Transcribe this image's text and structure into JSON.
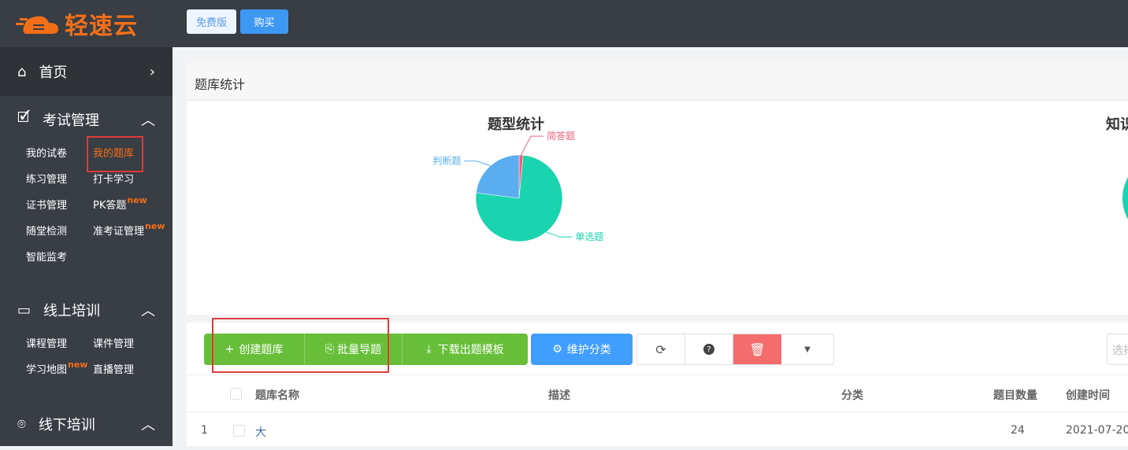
{
  "header": {
    "logo_text": "轻速云",
    "free_label": "免费版",
    "buy_label": "购买"
  },
  "sidebar": {
    "home": "首页",
    "exam": {
      "label": "考试管理",
      "items": [
        {
          "label": "我的试卷"
        },
        {
          "label": "我的题库",
          "active": true
        },
        {
          "label": "练习管理"
        },
        {
          "label": "打卡学习"
        },
        {
          "label": "证书管理"
        },
        {
          "label": "PK答题",
          "badge": "new"
        },
        {
          "label": "随堂检测"
        },
        {
          "label": "准考证管理",
          "badge": "new"
        },
        {
          "label": "智能监考"
        }
      ]
    },
    "online": {
      "label": "线上培训",
      "items": [
        {
          "label": "课程管理"
        },
        {
          "label": "课件管理"
        },
        {
          "label": "学习地图",
          "badge": "new"
        },
        {
          "label": "直播管理"
        }
      ]
    },
    "offline": {
      "label": "线下培训"
    }
  },
  "stats": {
    "title": "题库统计",
    "chart2_title": "知识点统计"
  },
  "chart_data": {
    "type": "pie",
    "title": "题型统计",
    "categories": [
      "单选题",
      "判断题",
      "简答题"
    ],
    "values": [
      75.5,
      23,
      1.5
    ],
    "colors": [
      "#1ad4b0",
      "#5aaef0",
      "#f0607a"
    ]
  },
  "toolbar": {
    "create": "创建题库",
    "import": "批量导题",
    "download": "下载出题模板",
    "categories": "维护分类",
    "search_placeholder": "选择"
  },
  "table": {
    "headers": {
      "name": "题库名称",
      "desc": "描述",
      "category": "分类",
      "count": "题目数量",
      "created": "创建时间"
    },
    "rows": [
      {
        "index": "1",
        "name": "大",
        "desc": "",
        "category": "",
        "count": "24",
        "created": "2021-07-20"
      }
    ]
  }
}
